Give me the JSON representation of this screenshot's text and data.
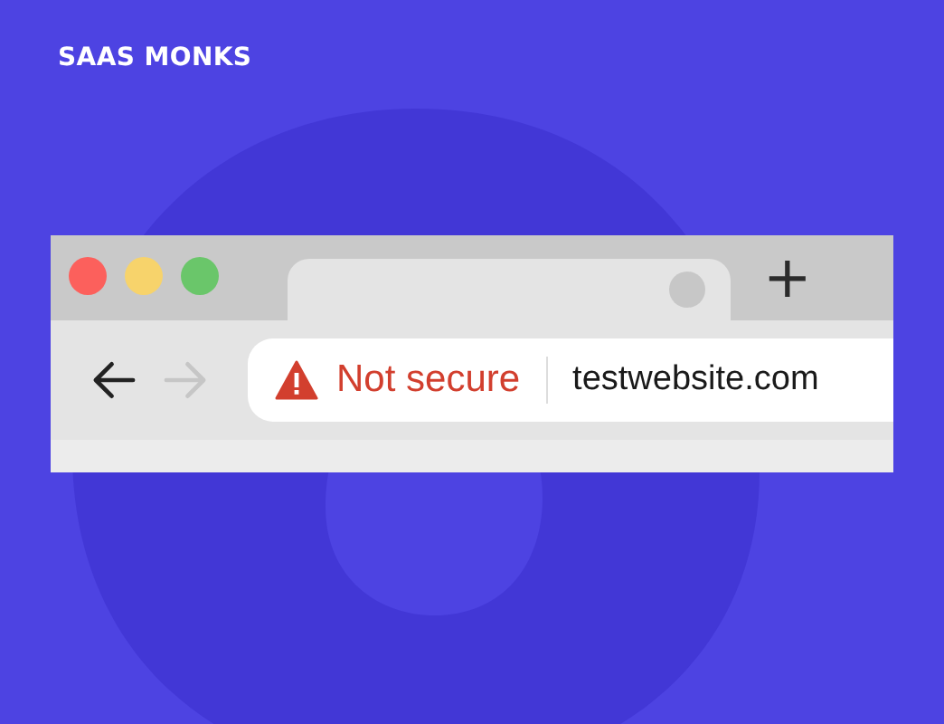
{
  "brand": {
    "logo": "SAAS MONKS"
  },
  "browser": {
    "window_controls": [
      {
        "color": "#fc605c"
      },
      {
        "color": "#f7d36b"
      },
      {
        "color": "#6ac66a"
      }
    ],
    "new_tab": "+",
    "nav": [
      {
        "kind": "back",
        "disabled": false
      },
      {
        "kind": "forward",
        "disabled": true
      }
    ],
    "address_bar": {
      "secure": false,
      "security": "Not secure",
      "url": "testwebsite.com"
    }
  }
}
